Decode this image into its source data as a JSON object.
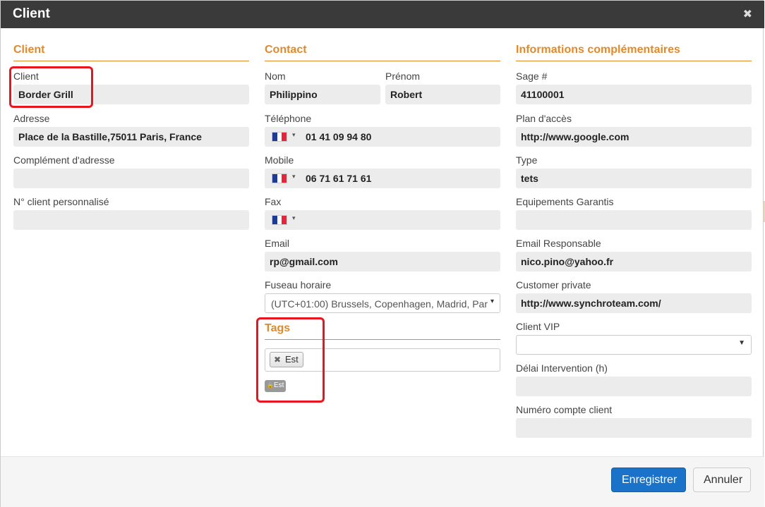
{
  "modal": {
    "title": "Client",
    "close_glyph": "✖"
  },
  "client_section": {
    "title": "Client",
    "client_label": "Client",
    "client_value": "Border Grill",
    "address_label": "Adresse",
    "address_value": "Place de la Bastille,75011 Paris, France",
    "complement_label": "Complément d'adresse",
    "complement_value": "",
    "custom_id_label": "N° client personnalisé",
    "custom_id_value": ""
  },
  "contact_section": {
    "title": "Contact",
    "nom_label": "Nom",
    "nom_value": "Philippino",
    "prenom_label": "Prénom",
    "prenom_value": "Robert",
    "phone_label": "Téléphone",
    "phone_value": "01 41 09 94 80",
    "mobile_label": "Mobile",
    "mobile_value": "06 71 61 71 61",
    "fax_label": "Fax",
    "fax_value": "",
    "email_label": "Email",
    "email_value": "rp@gmail.com",
    "timezone_label": "Fuseau horaire",
    "timezone_value": "(UTC+01:00) Brussels, Copenhagen, Madrid, Par",
    "flag_icon": "france-flag-icon",
    "caret_glyph": "▾"
  },
  "tags_section": {
    "title": "Tags",
    "chips": [
      "Est"
    ],
    "chip_remove_glyph": "✖",
    "badge": "Est",
    "badge_lock_glyph": "🔒"
  },
  "info_section": {
    "title": "Informations complémentaires",
    "sage_label": "Sage #",
    "sage_value": "41100001",
    "plan_label": "Plan d'accès",
    "plan_value": "http://www.google.com",
    "type_label": "Type",
    "type_value": "tets",
    "equip_label": "Equipements Garantis",
    "equip_value": "",
    "email_resp_label": "Email Responsable",
    "email_resp_value": "nico.pino@yahoo.fr",
    "customer_private_label": "Customer private",
    "customer_private_value": "http://www.synchroteam.com/",
    "vip_label": "Client VIP",
    "vip_value": "",
    "vip_arrow": "▼",
    "delai_label": "Délai Intervention (h)",
    "delai_value": "",
    "compte_label": "Numéro compte client",
    "compte_value": ""
  },
  "footer": {
    "save_label": "Enregistrer",
    "cancel_label": "Annuler"
  },
  "colors": {
    "accent": "#e08a2c",
    "primary_button": "#1a73c9",
    "highlight": "#e8141e",
    "header_bg": "#3a3a3a"
  }
}
